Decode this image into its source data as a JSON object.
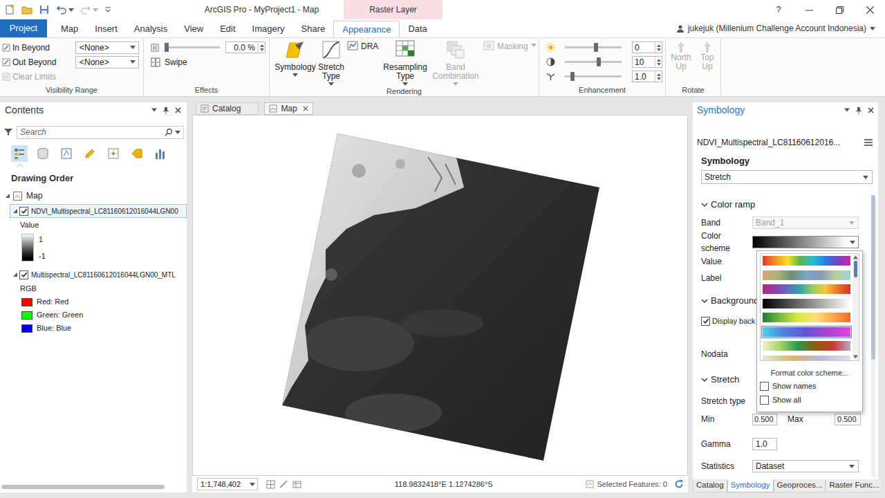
{
  "window": {
    "title": "ArcGIS Pro - MyProject1 - Map",
    "context_tab": "Raster Layer",
    "help": "?"
  },
  "ribbon_tabs": [
    {
      "label": "Project",
      "kind": "backstage",
      "selected": false
    },
    {
      "label": "Map",
      "kind": "tab",
      "selected": false
    },
    {
      "label": "Insert",
      "kind": "tab",
      "selected": false
    },
    {
      "label": "Analysis",
      "kind": "tab",
      "selected": false
    },
    {
      "label": "View",
      "kind": "tab",
      "selected": false
    },
    {
      "label": "Edit",
      "kind": "tab",
      "selected": false
    },
    {
      "label": "Imagery",
      "kind": "tab",
      "selected": false
    },
    {
      "label": "Share",
      "kind": "tab",
      "selected": false
    },
    {
      "label": "Appearance",
      "kind": "tab",
      "selected": true
    },
    {
      "label": "Data",
      "kind": "tab",
      "selected": false
    }
  ],
  "user": "jukejuk (Millenium Challenge Account Indonesia)",
  "visibility_range": {
    "label": "Visibility Range",
    "rows": [
      {
        "label": "In Beyond",
        "value": "<None>"
      },
      {
        "label": "Out Beyond",
        "value": "<None>"
      }
    ],
    "clear_limits": {
      "label": "Clear Limits",
      "disabled": true
    }
  },
  "effects": {
    "label": "Effects",
    "transparency": {
      "level": 0.0,
      "reading": "0.0 %"
    },
    "swipe": "Swipe"
  },
  "rendering": {
    "label": "Rendering",
    "buttons": [
      {
        "label": "Symbology",
        "kind": "large",
        "disabled": false
      },
      {
        "label": "Stretch Type",
        "kind": "large",
        "disabled": false
      },
      {
        "label": "DRA",
        "kind": "small",
        "disabled": false
      },
      {
        "label": "Resampling Type",
        "kind": "large",
        "disabled": false
      },
      {
        "label": "Band Combination",
        "kind": "large",
        "disabled": true
      },
      {
        "label": "Masking",
        "kind": "small",
        "disabled": true
      }
    ]
  },
  "enhancement": {
    "label": "Enhancement",
    "sliders": [
      {
        "kind": "brightness",
        "level": 0.55,
        "reading": "0"
      },
      {
        "kind": "contrast",
        "level": 0.6,
        "reading": "10"
      },
      {
        "kind": "gamma",
        "level": 0.1,
        "reading": "1.0"
      }
    ]
  },
  "rotate": {
    "label": "Rotate",
    "buttons": [
      {
        "label": "North Up",
        "disabled": true
      },
      {
        "label": "Top Up",
        "disabled": true
      }
    ]
  },
  "contents": {
    "title": "Contents",
    "search_placeholder": "Search",
    "section": "Drawing Order",
    "map": {
      "label": "Map",
      "expanded": true
    },
    "layers": [
      {
        "name": "NDVI_Multispectral_LC81160612016044LGN00",
        "checked": true,
        "expanded": true,
        "selected": true,
        "legend": {
          "title": "Value",
          "kind": "gradient",
          "high": "1",
          "low": "-1",
          "items": []
        }
      },
      {
        "name": "Multispectral_LC81160612016044LGN00_MTL",
        "checked": true,
        "expanded": true,
        "selected": false,
        "legend": {
          "title": "RGB",
          "kind": "swatches",
          "high": "",
          "low": "",
          "items": [
            {
              "label": "Red: Red",
              "color": "#ff0000"
            },
            {
              "label": "Green: Green",
              "color": "#00ff00"
            },
            {
              "label": "Blue: Blue",
              "color": "#0000ff"
            }
          ]
        }
      }
    ]
  },
  "map_view": {
    "tabs": [
      {
        "label": "Catalog",
        "selected": false
      },
      {
        "label": "Map",
        "selected": true
      }
    ],
    "scale": "1:1,748,402",
    "coordinates": "118.9832418°E 1.1274286°S",
    "selected_features": "Selected Features: 0"
  },
  "symbology_pane": {
    "title": "Symbology",
    "layer": "NDVI_Multispectral_LC81160612016...",
    "heading": "Symbology",
    "renderer": "Stretch",
    "color_ramp_section": {
      "label": "Color ramp",
      "expanded": true
    },
    "band": {
      "label": "Band",
      "value": "Band_1",
      "disabled": true
    },
    "color_scheme": {
      "label": "Color scheme",
      "stops": [
        "#000000",
        "#ffffff"
      ]
    },
    "value_label": "Value",
    "label_label": "Label",
    "background_section": {
      "label": "Background",
      "expanded": true
    },
    "display_background": {
      "label": "Display back",
      "checked": true
    },
    "nodata_label": "Nodata",
    "stretch_section": {
      "label": "Stretch",
      "expanded": true
    },
    "stretch_type_label": "Stretch type",
    "min": {
      "label": "Min",
      "value": "0.500"
    },
    "max": {
      "label": "Max",
      "value": "0.500"
    },
    "gamma": {
      "label": "Gamma",
      "value": "1.0"
    },
    "statistics": {
      "label": "Statistics",
      "value": "Dataset"
    },
    "bottom_tabs": [
      {
        "label": "Catalog",
        "selected": false
      },
      {
        "label": "Symbology",
        "selected": true
      },
      {
        "label": "Geoproces...",
        "selected": false
      },
      {
        "label": "Raster Func...",
        "selected": false
      }
    ]
  },
  "color_scheme_menu": {
    "ramps": [
      {
        "stops": [
          "#e8332a",
          "#f7941d",
          "#f4e11c",
          "#55b848",
          "#22c0d8",
          "#2a7de1",
          "#7b3fc4",
          "#d6239b"
        ],
        "highlighted": false
      },
      {
        "stops": [
          "#d8a46c",
          "#a9b27a",
          "#6e8f7a",
          "#7aa5c4",
          "#8898b4",
          "#b9cf98",
          "#9fd6da"
        ],
        "highlighted": false
      },
      {
        "stops": [
          "#b8257a",
          "#8e3fb3",
          "#5d6cc4",
          "#2fa7a0",
          "#9ccd5c",
          "#f5c83a",
          "#ee7222",
          "#d8312b"
        ],
        "highlighted": false
      },
      {
        "stops": [
          "#000000",
          "#ffffff"
        ],
        "highlighted": false
      },
      {
        "stops": [
          "#1c7c36",
          "#76bd3c",
          "#d8ea3a",
          "#fde07c",
          "#fbaa45",
          "#f2692c"
        ],
        "highlighted": false
      },
      {
        "stops": [
          "#48d4e6",
          "#4f7ee0",
          "#6a4fd8",
          "#a945d0",
          "#e640e6"
        ],
        "highlighted": true
      },
      {
        "stops": [
          "#f3f1cf",
          "#a5d46a",
          "#2b9a4f",
          "#8c5a12",
          "#c83a2a",
          "#b3a8d6"
        ],
        "highlighted": false
      },
      {
        "stops": [
          "#d8f0d0",
          "#d9b668",
          "#bcb8da",
          "#e2e2e2"
        ],
        "highlighted": false
      }
    ],
    "format": "Format color scheme...",
    "options": [
      {
        "label": "Show names",
        "checked": false
      },
      {
        "label": "Show all",
        "checked": false
      }
    ]
  }
}
